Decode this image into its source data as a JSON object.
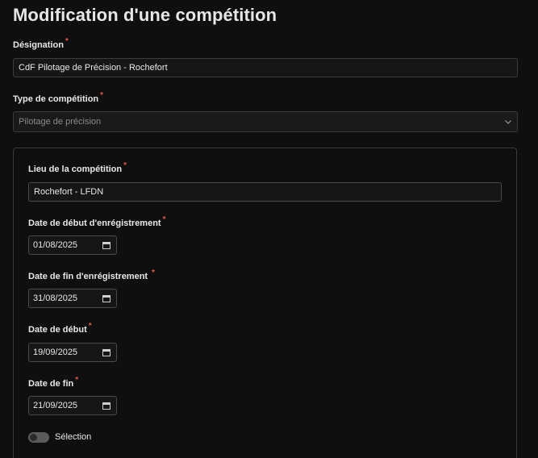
{
  "page": {
    "title": "Modification d'une compétition"
  },
  "form": {
    "designation": {
      "label": "Désignation",
      "required_mark": "*",
      "value": "CdF Pilotage de Précision - Rochefort"
    },
    "type": {
      "label": "Type de compétition",
      "required_mark": "*",
      "value": "Pilotage de précision",
      "icon": "chevron-down-icon"
    },
    "lieu": {
      "label": "Lieu de la compétition",
      "required_mark": "*",
      "value": "Rochefort - LFDN"
    },
    "date_debut_enregistrement": {
      "label": "Date de début d'enrégistrement",
      "required_mark": "*",
      "value": "01/08/2025",
      "icon": "calendar-icon"
    },
    "date_fin_enregistrement": {
      "label": "Date de fin d'enrégistrement ",
      "required_mark": "*",
      "value": "31/08/2025",
      "icon": "calendar-icon"
    },
    "date_debut": {
      "label": "Date de début",
      "required_mark": "*",
      "value": "19/09/2025",
      "icon": "calendar-icon"
    },
    "date_fin": {
      "label": "Date de fin",
      "required_mark": "*",
      "value": "21/09/2025",
      "icon": "calendar-icon"
    },
    "selection": {
      "label": "Sélection",
      "checked": false
    }
  },
  "colors": {
    "background": "#0f0f0f",
    "required": "#e0584a",
    "border": "#3a3a3a"
  }
}
